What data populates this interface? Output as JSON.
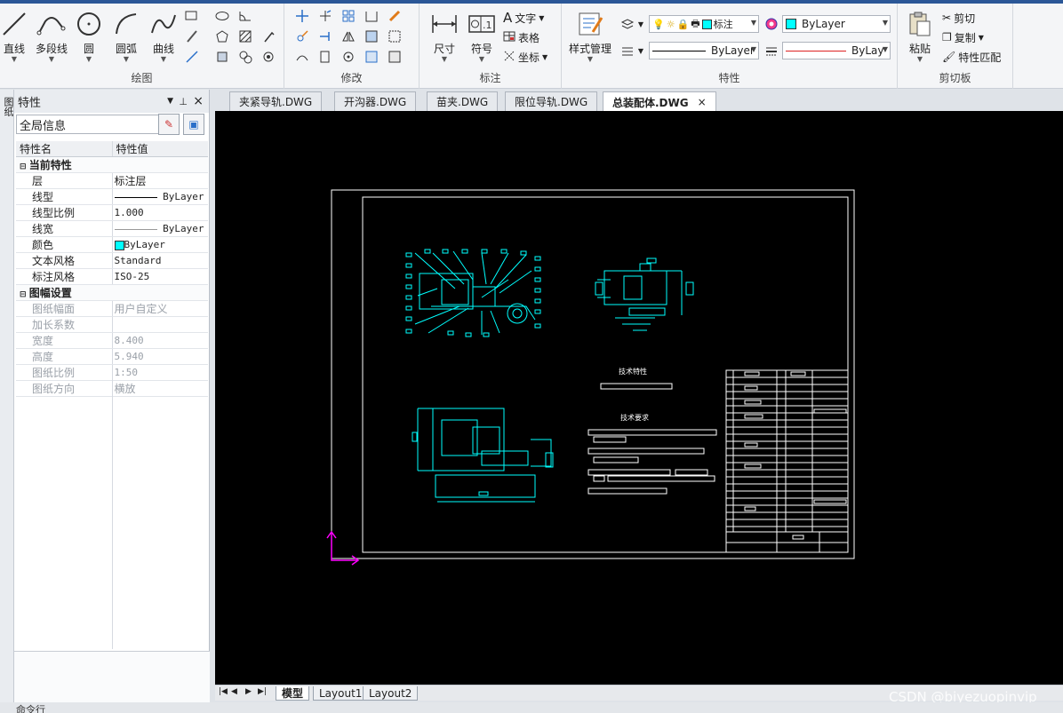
{
  "ribbon": {
    "draw": {
      "title": "绘图",
      "line": "直线",
      "polyline": "多段线",
      "circle": "圆",
      "arc": "圆弧",
      "curve": "曲线"
    },
    "modify": {
      "title": "修改"
    },
    "annotate": {
      "title": "标注",
      "dimension": "尺寸",
      "symbol": "符号",
      "text": "文字",
      "table": "表格",
      "coordinate": "坐标"
    },
    "properties": {
      "title": "特性",
      "style_manager": "样式管理",
      "layer_value": "标注",
      "color_value": "ByLayer",
      "linetype_value": "ByLayer",
      "lineweight_value": "ByLay·"
    },
    "clipboard": {
      "title": "剪切板",
      "paste": "粘贴",
      "cut": "剪切",
      "copy": "复制",
      "match": "特性匹配"
    }
  },
  "panel": {
    "title": "特性",
    "scope": "全局信息",
    "col_name": "特性名",
    "col_value": "特性值",
    "sec_current": "当前特性",
    "sec_sheet": "图幅设置",
    "rows": [
      {
        "name": "层",
        "value": "标注层"
      },
      {
        "name": "线型",
        "value": "ByLayer"
      },
      {
        "name": "线型比例",
        "value": "1.000"
      },
      {
        "name": "线宽",
        "value": "ByLayer"
      },
      {
        "name": "颜色",
        "value": "ByLayer"
      },
      {
        "name": "文本风格",
        "value": "Standard"
      },
      {
        "name": "标注风格",
        "value": "ISO-25"
      }
    ],
    "sheet_rows": [
      {
        "name": "图纸幅面",
        "value": "用户自定义"
      },
      {
        "name": "加长系数",
        "value": ""
      },
      {
        "name": "宽度",
        "value": "8.400"
      },
      {
        "name": "高度",
        "value": "5.940"
      },
      {
        "name": "图纸比例",
        "value": "1:50"
      },
      {
        "name": "图纸方向",
        "value": "横放"
      }
    ],
    "side_label": "图纸"
  },
  "tabs": [
    {
      "label": "夹紧导轨.DWG",
      "active": false
    },
    {
      "label": "开沟器.DWG",
      "active": false
    },
    {
      "label": "苗夹.DWG",
      "active": false
    },
    {
      "label": "限位导轨.DWG",
      "active": false
    },
    {
      "label": "总装配体.DWG",
      "active": true
    }
  ],
  "close_glyph": "×",
  "drawing": {
    "tech_char": "技术特性",
    "tech_req": "技术要求"
  },
  "layout_tabs": [
    {
      "label": "模型",
      "active": true
    },
    {
      "label": "Layout1",
      "active": false
    },
    {
      "label": "Layout2",
      "active": false
    }
  ],
  "command_label": "命令行",
  "watermark": "CSDN @biyezuopinvip",
  "colors": {
    "accent": "#2b5797",
    "cad_line": "#00ffff",
    "cad_white": "#ffffff",
    "ucs": "#ff00ff"
  }
}
